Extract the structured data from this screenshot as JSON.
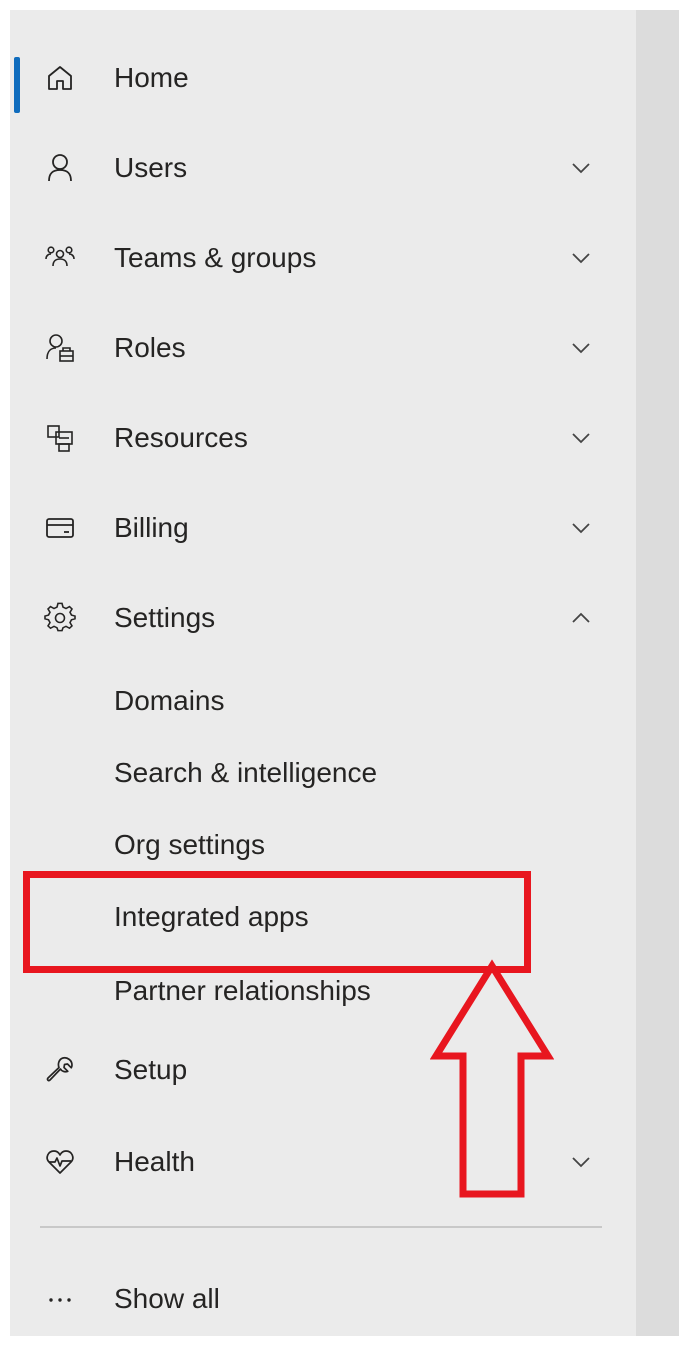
{
  "nav": {
    "items": [
      {
        "label": "Home",
        "icon": "home-icon",
        "expandable": false
      },
      {
        "label": "Users",
        "icon": "user-icon",
        "expandable": true,
        "state": "collapsed"
      },
      {
        "label": "Teams & groups",
        "icon": "people-group-icon",
        "expandable": true,
        "state": "collapsed"
      },
      {
        "label": "Roles",
        "icon": "person-badge-icon",
        "expandable": true,
        "state": "collapsed"
      },
      {
        "label": "Resources",
        "icon": "resources-icon",
        "expandable": true,
        "state": "collapsed"
      },
      {
        "label": "Billing",
        "icon": "credit-card-icon",
        "expandable": true,
        "state": "collapsed"
      },
      {
        "label": "Settings",
        "icon": "gear-icon",
        "expandable": true,
        "state": "expanded"
      },
      {
        "label": "Setup",
        "icon": "wrench-icon",
        "expandable": false
      },
      {
        "label": "Health",
        "icon": "heart-pulse-icon",
        "expandable": true,
        "state": "collapsed"
      }
    ],
    "settings_children": [
      {
        "label": "Domains"
      },
      {
        "label": "Search & intelligence"
      },
      {
        "label": "Org settings"
      },
      {
        "label": "Integrated apps"
      },
      {
        "label": "Partner relationships"
      }
    ],
    "show_all": {
      "label": "Show all",
      "icon": "more-horizontal-icon"
    },
    "active_item": "Home"
  },
  "annotation": {
    "highlighted_item": "Integrated apps",
    "color": "#e8161f"
  },
  "colors": {
    "panel": "#ebebeb",
    "accent": "#0f6cbd",
    "text": "#252423"
  }
}
